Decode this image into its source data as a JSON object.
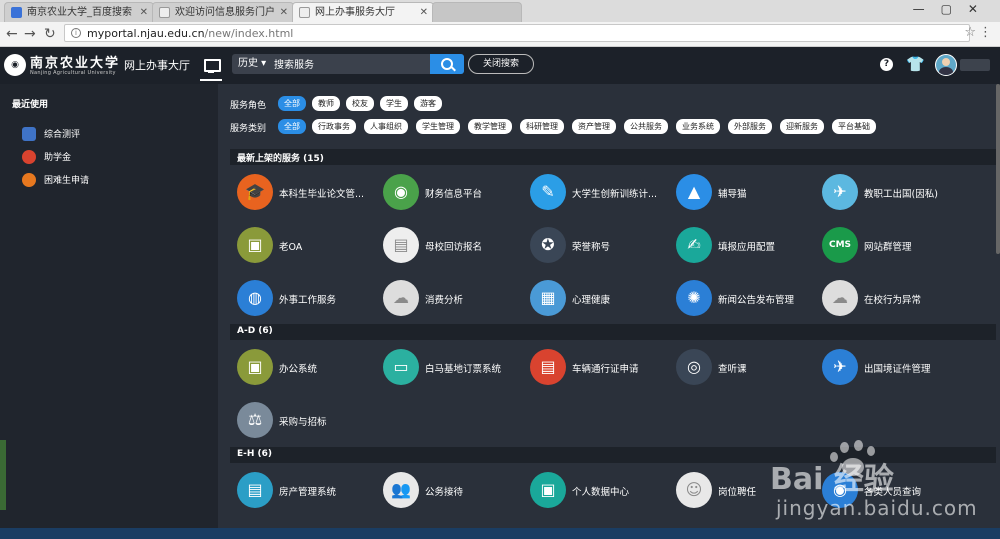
{
  "browser": {
    "tabs": [
      {
        "title": "南京农业大学_百度搜索",
        "color": "#3a72d8"
      },
      {
        "title": "欢迎访问信息服务门户",
        "color": "#9a9a9a"
      },
      {
        "title": "网上办事服务大厅",
        "color": "#9a9a9a"
      }
    ],
    "url_host": "myportal.njau.edu.cn",
    "url_path": "/new/index.html"
  },
  "header": {
    "logo_text": "南京农业大学",
    "logo_sub": "Nanjing Agricultural University",
    "app_title": "网上办事大厅",
    "history_label": "历史",
    "search_placeholder": "搜索服务",
    "close_search_label": "关闭搜索",
    "help_icon_glyph": "?"
  },
  "sidebar": {
    "title": "最近使用",
    "items": [
      {
        "label": "综合测评",
        "color": "#3f73c6"
      },
      {
        "label": "助学金",
        "color": "#d9432f"
      },
      {
        "label": "困难生申请",
        "color": "#e7781f"
      }
    ]
  },
  "filters": {
    "role_label": "服务角色",
    "roles": [
      "全部",
      "教师",
      "校友",
      "学生",
      "游客"
    ],
    "category_label": "服务类别",
    "categories": [
      "全部",
      "行政事务",
      "人事组织",
      "学生管理",
      "教学管理",
      "科研管理",
      "资产管理",
      "公共服务",
      "业务系统",
      "外部服务",
      "迎新服务",
      "平台基础"
    ]
  },
  "sections": [
    {
      "title": "最新上架的服务 (15)",
      "items": [
        {
          "label": "本科生毕业论文管...",
          "color": "#e8631f",
          "glyph": "🎓"
        },
        {
          "label": "财务信息平台",
          "color": "#4aa24a",
          "glyph": "◉"
        },
        {
          "label": "大学生创新训练计...",
          "color": "#2b9ee6",
          "glyph": "✎"
        },
        {
          "label": "辅导猫",
          "color": "#2b8ee6",
          "glyph": "▲"
        },
        {
          "label": "教职工出国(因私)",
          "color": "#5cb8e0",
          "glyph": "✈"
        },
        {
          "label": "老OA",
          "color": "#8a9a3a",
          "glyph": "▣"
        },
        {
          "label": "母校回访报名",
          "color": "#eeeeee",
          "glyph": "▤"
        },
        {
          "label": "荣誉称号",
          "color": "#3a4656",
          "glyph": "✪"
        },
        {
          "label": "填报应用配置",
          "color": "#1aa89a",
          "glyph": "✍"
        },
        {
          "label": "网站群管理",
          "color": "#1a9a4a",
          "glyph": "CMS"
        },
        {
          "label": "外事工作服务",
          "color": "#2b7fd6",
          "glyph": "◍"
        },
        {
          "label": "消费分析",
          "color": "#dddddd",
          "glyph": "☁"
        },
        {
          "label": "心理健康",
          "color": "#4a9ad6",
          "glyph": "▦"
        },
        {
          "label": "新闻公告发布管理",
          "color": "#2b7fd6",
          "glyph": "✺"
        },
        {
          "label": "在校行为异常",
          "color": "#dddddd",
          "glyph": "☁"
        }
      ]
    },
    {
      "title": "A-D (6)",
      "items": [
        {
          "label": "办公系统",
          "color": "#8a9a3a",
          "glyph": "▣"
        },
        {
          "label": "白马基地订票系统",
          "color": "#2bb0a0",
          "glyph": "▭"
        },
        {
          "label": "车辆通行证申请",
          "color": "#d9432f",
          "glyph": "▤"
        },
        {
          "label": "查听课",
          "color": "#3a4656",
          "glyph": "◎"
        },
        {
          "label": "出国境证件管理",
          "color": "#2b7fd6",
          "glyph": "✈"
        },
        {
          "label": "采购与招标",
          "color": "#7a8a9a",
          "glyph": "⚖"
        }
      ]
    },
    {
      "title": "E-H (6)",
      "items": [
        {
          "label": "房产管理系统",
          "color": "#2b9ec6",
          "glyph": "▤"
        },
        {
          "label": "公务接待",
          "color": "#e8e8e8",
          "glyph": "👥"
        },
        {
          "label": "个人数据中心",
          "color": "#1aa89a",
          "glyph": "▣"
        },
        {
          "label": "岗位聘任",
          "color": "#e8e8e8",
          "glyph": "☺"
        },
        {
          "label": "各类人员查询",
          "color": "#2b7fd6",
          "glyph": "◉"
        }
      ]
    }
  ],
  "watermark": {
    "brand": "Bai  经验",
    "url": "jingyan.baidu.com"
  }
}
